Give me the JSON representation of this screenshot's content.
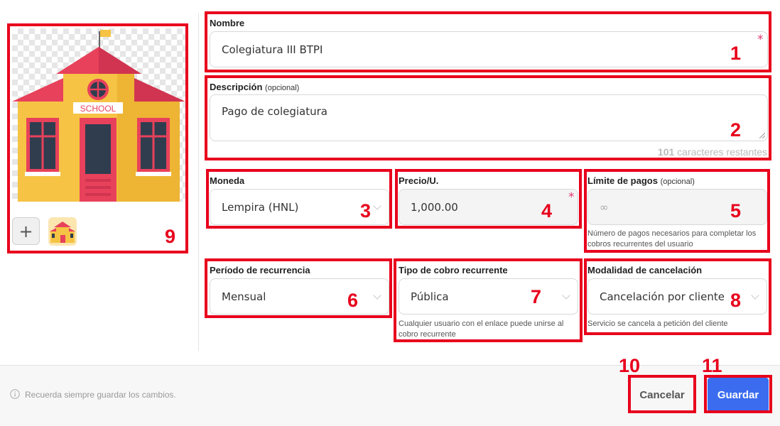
{
  "image_panel": {
    "sign_text": "SCHOOL",
    "add_button_label": "+",
    "annotation": "9"
  },
  "form": {
    "name": {
      "label": "Nombre",
      "value": "Colegiatura III BTPI",
      "required_mark": "*",
      "annotation": "1"
    },
    "description": {
      "label": "Descripción",
      "optional_label": "(opcional)",
      "value": "Pago de colegiatura",
      "remaining_count": "101",
      "remaining_label": "caracteres restantes",
      "annotation": "2"
    },
    "currency": {
      "label": "Moneda",
      "value": "Lempira (HNL)",
      "annotation": "3"
    },
    "price": {
      "label": "Precio/U.",
      "value": "1,000.00",
      "required_mark": "*",
      "annotation": "4"
    },
    "payment_limit": {
      "label": "Límite de pagos",
      "optional_label": "(opcional)",
      "placeholder": "∞",
      "help": "Número de pagos necesarios para completar los cobros recurrentes del usuario",
      "annotation": "5"
    },
    "recurrence_period": {
      "label": "Período de recurrencia",
      "value": "Mensual",
      "annotation": "6"
    },
    "charge_type": {
      "label": "Tipo de cobro recurrente",
      "value": "Pública",
      "help": "Cualquier usuario con el enlace puede unirse al cobro recurrente",
      "annotation": "7"
    },
    "cancellation": {
      "label": "Modalidad de cancelación",
      "value": "Cancelación por cliente",
      "help": "Servicio se cancela a petición del cliente",
      "annotation": "8"
    }
  },
  "footer": {
    "info_icon": "info-icon",
    "hint": "Recuerda siempre guardar los cambios.",
    "cancel_label": "Cancelar",
    "cancel_annotation": "10",
    "save_label": "Guardar",
    "save_annotation": "11"
  },
  "colors": {
    "annotation_red": "#e8001c",
    "primary_blue": "#3b6cf0",
    "required_pink": "#e03a75"
  }
}
